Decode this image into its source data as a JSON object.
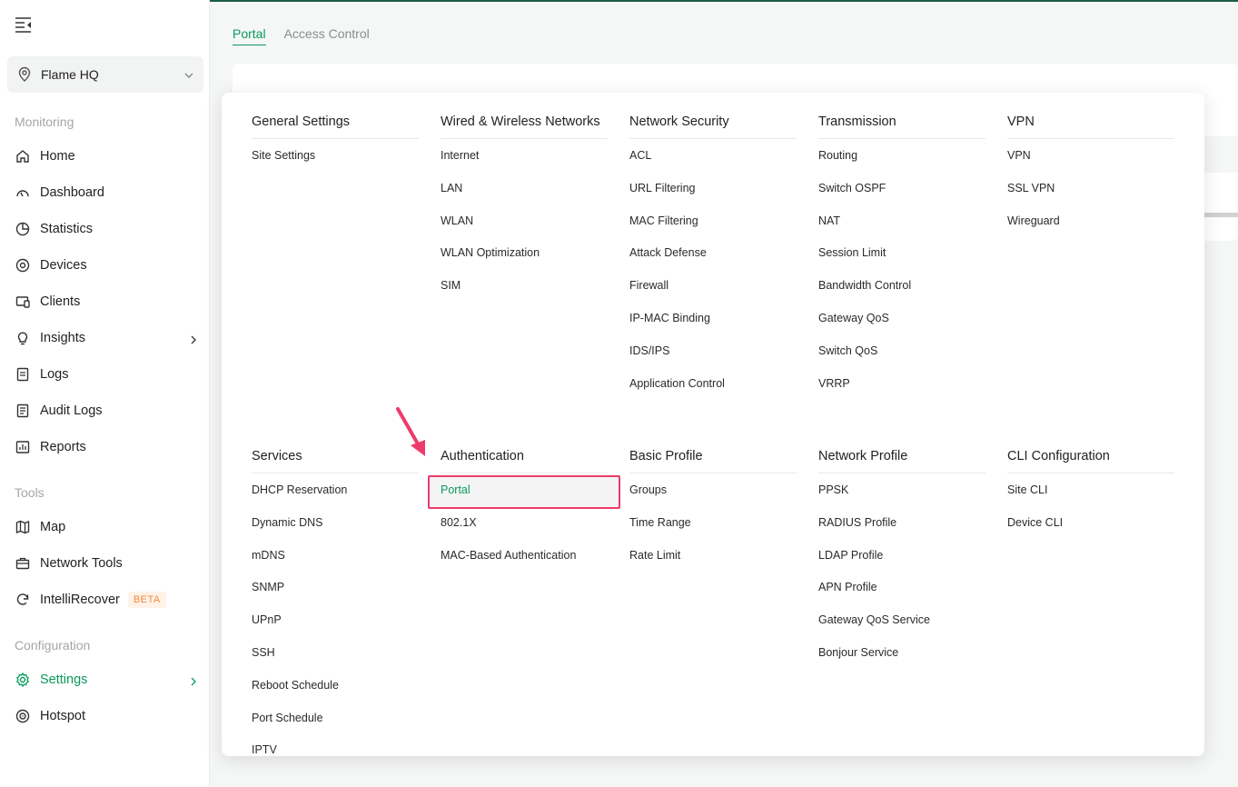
{
  "sidebar": {
    "site": "Flame HQ",
    "sections": {
      "monitoring": "Monitoring",
      "tools": "Tools",
      "configuration": "Configuration"
    },
    "items": {
      "home": "Home",
      "dashboard": "Dashboard",
      "statistics": "Statistics",
      "devices": "Devices",
      "clients": "Clients",
      "insights": "Insights",
      "logs": "Logs",
      "audit_logs": "Audit Logs",
      "reports": "Reports",
      "map": "Map",
      "network_tools": "Network Tools",
      "intellirecover": "IntelliRecover",
      "settings": "Settings",
      "hotspot": "Hotspot"
    },
    "beta_badge": "BETA"
  },
  "tabs": {
    "portal": "Portal",
    "access_control": "Access Control"
  },
  "menu": {
    "general": {
      "title": "General Settings",
      "items": [
        "Site Settings"
      ]
    },
    "wired": {
      "title": "Wired & Wireless Networks",
      "items": [
        "Internet",
        "LAN",
        "WLAN",
        "WLAN Optimization",
        "SIM"
      ]
    },
    "security": {
      "title": "Network Security",
      "items": [
        "ACL",
        "URL Filtering",
        "MAC Filtering",
        "Attack Defense",
        "Firewall",
        "IP-MAC Binding",
        "IDS/IPS",
        "Application Control"
      ]
    },
    "transmission": {
      "title": "Transmission",
      "items": [
        "Routing",
        "Switch OSPF",
        "NAT",
        "Session Limit",
        "Bandwidth Control",
        "Gateway QoS",
        "Switch QoS",
        "VRRP"
      ]
    },
    "vpn": {
      "title": "VPN",
      "items": [
        "VPN",
        "SSL VPN",
        "Wireguard"
      ]
    },
    "services": {
      "title": "Services",
      "items": [
        "DHCP Reservation",
        "Dynamic DNS",
        "mDNS",
        "SNMP",
        "UPnP",
        "SSH",
        "Reboot Schedule",
        "Port Schedule",
        "IPTV"
      ]
    },
    "auth": {
      "title": "Authentication",
      "items": [
        "Portal",
        "802.1X",
        "MAC-Based Authentication"
      ]
    },
    "basic_profile": {
      "title": "Basic Profile",
      "items": [
        "Groups",
        "Time Range",
        "Rate Limit"
      ]
    },
    "network_profile": {
      "title": "Network Profile",
      "items": [
        "PPSK",
        "RADIUS Profile",
        "LDAP Profile",
        "APN Profile",
        "Gateway QoS Service",
        "Bonjour Service"
      ]
    },
    "cli": {
      "title": "CLI Configuration",
      "items": [
        "Site CLI",
        "Device CLI"
      ]
    }
  },
  "colors": {
    "accent": "#0a9a5c",
    "highlight_border": "#ee3a6c",
    "beta": "#f08a3e"
  }
}
